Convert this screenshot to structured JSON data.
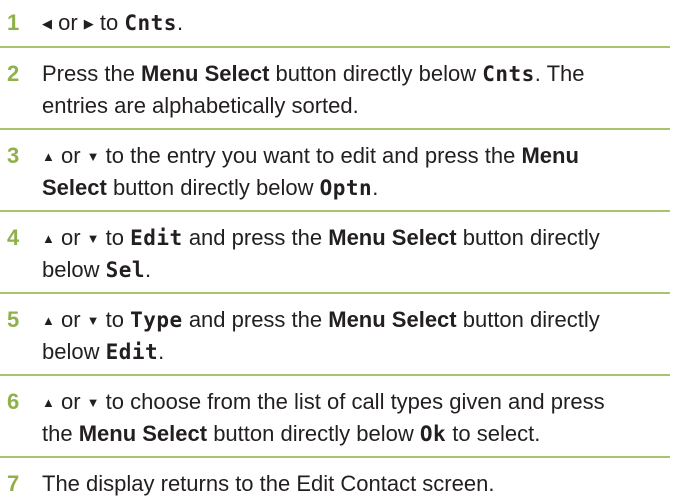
{
  "steps": [
    {
      "number": "1",
      "parts": [
        {
          "t": "icon",
          "icon": "left-arrow-icon",
          "v": "◀"
        },
        {
          "t": "text",
          "v": " or "
        },
        {
          "t": "icon",
          "icon": "right-arrow-icon",
          "v": "▶"
        },
        {
          "t": "text",
          "v": " to "
        },
        {
          "t": "lcd",
          "v": "Cnts"
        },
        {
          "t": "text",
          "v": "."
        }
      ]
    },
    {
      "number": "2",
      "parts": [
        {
          "t": "text",
          "v": "Press the "
        },
        {
          "t": "bold",
          "v": "Menu Select"
        },
        {
          "t": "text",
          "v": " button directly below "
        },
        {
          "t": "lcd",
          "v": "Cnts"
        },
        {
          "t": "text",
          "v": ". The"
        },
        {
          "t": "br"
        },
        {
          "t": "text",
          "v": "entries are alphabetically sorted."
        }
      ]
    },
    {
      "number": "3",
      "parts": [
        {
          "t": "icon",
          "icon": "up-arrow-icon",
          "v": "▲"
        },
        {
          "t": "text",
          "v": " or "
        },
        {
          "t": "icon",
          "icon": "down-arrow-icon",
          "v": "▼"
        },
        {
          "t": "text",
          "v": " to the entry you want to edit and press the "
        },
        {
          "t": "bold",
          "v": "Menu"
        },
        {
          "t": "br"
        },
        {
          "t": "bold",
          "v": "Select"
        },
        {
          "t": "text",
          "v": " button directly below "
        },
        {
          "t": "lcd",
          "v": "Optn"
        },
        {
          "t": "text",
          "v": "."
        }
      ]
    },
    {
      "number": "4",
      "parts": [
        {
          "t": "icon",
          "icon": "up-arrow-icon",
          "v": "▲"
        },
        {
          "t": "text",
          "v": " or "
        },
        {
          "t": "icon",
          "icon": "down-arrow-icon",
          "v": "▼"
        },
        {
          "t": "text",
          "v": " to "
        },
        {
          "t": "lcd",
          "v": "Edit"
        },
        {
          "t": "text",
          "v": " and press the "
        },
        {
          "t": "bold",
          "v": "Menu Select"
        },
        {
          "t": "text",
          "v": " button directly"
        },
        {
          "t": "br"
        },
        {
          "t": "text",
          "v": "below "
        },
        {
          "t": "lcd",
          "v": "Sel"
        },
        {
          "t": "text",
          "v": "."
        }
      ]
    },
    {
      "number": "5",
      "parts": [
        {
          "t": "icon",
          "icon": "up-arrow-icon",
          "v": "▲"
        },
        {
          "t": "text",
          "v": " or "
        },
        {
          "t": "icon",
          "icon": "down-arrow-icon",
          "v": "▼"
        },
        {
          "t": "text",
          "v": " to "
        },
        {
          "t": "lcd",
          "v": "Type"
        },
        {
          "t": "text",
          "v": " and press the "
        },
        {
          "t": "bold",
          "v": "Menu Select"
        },
        {
          "t": "text",
          "v": " button directly"
        },
        {
          "t": "br"
        },
        {
          "t": "text",
          "v": "below "
        },
        {
          "t": "lcd",
          "v": "Edit"
        },
        {
          "t": "text",
          "v": "."
        }
      ]
    },
    {
      "number": "6",
      "parts": [
        {
          "t": "icon",
          "icon": "up-arrow-icon",
          "v": "▲"
        },
        {
          "t": "text",
          "v": " or "
        },
        {
          "t": "icon",
          "icon": "down-arrow-icon",
          "v": "▼"
        },
        {
          "t": "text",
          "v": " to choose from the list of call types given and press"
        },
        {
          "t": "br"
        },
        {
          "t": "text",
          "v": "the "
        },
        {
          "t": "bold",
          "v": "Menu Select"
        },
        {
          "t": "text",
          "v": " button directly below "
        },
        {
          "t": "lcd",
          "v": "Ok"
        },
        {
          "t": "text",
          "v": " to select."
        }
      ]
    },
    {
      "number": "7",
      "parts": [
        {
          "t": "text",
          "v": "The display returns to the Edit Contact screen."
        }
      ]
    }
  ],
  "colors": {
    "step_number": "#8fb04a",
    "rule": "#a9c46f",
    "text": "#231f20"
  }
}
